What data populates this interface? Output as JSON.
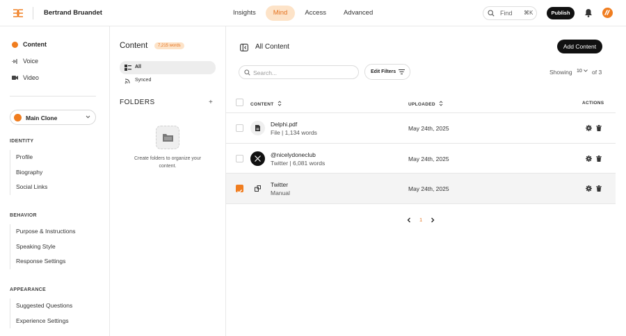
{
  "header": {
    "user_name": "Bertrand Bruandet",
    "nav": [
      {
        "label": "Insights",
        "active": false
      },
      {
        "label": "Mind",
        "active": true
      },
      {
        "label": "Access",
        "active": false
      },
      {
        "label": "Advanced",
        "active": false
      }
    ],
    "find_label": "Find",
    "find_shortcut": "⌘K",
    "publish_label": "Publish"
  },
  "sidebar": {
    "top_items": [
      {
        "label": "Content",
        "icon": "content-dot-icon"
      },
      {
        "label": "Voice",
        "icon": "voice-icon"
      },
      {
        "label": "Video",
        "icon": "video-icon"
      }
    ],
    "clone_label": "Main Clone",
    "identity_title": "IDENTITY",
    "identity_items": [
      "Profile",
      "Biography",
      "Social Links"
    ],
    "behavior_title": "BEHAVIOR",
    "behavior_items": [
      "Purpose & Instructions",
      "Speaking Style",
      "Response Settings"
    ],
    "appearance_title": "APPEARANCE",
    "appearance_items": [
      "Suggested Questions",
      "Experience Settings"
    ]
  },
  "content_panel": {
    "title": "Content",
    "word_badge": "7,215 words",
    "filters": [
      "All",
      "Synced"
    ],
    "folders_title": "FOLDERS",
    "folders_add": "+",
    "empty_text": "Create folders to organize your content."
  },
  "main": {
    "title": "All Content",
    "add_button": "Add Content",
    "search_placeholder": "Search...",
    "edit_filters": "Edit Filters",
    "showing_label": "Showing",
    "page_size": "10",
    "of_label": "of 3",
    "columns": {
      "content": "CONTENT",
      "uploaded": "UPLOADED",
      "actions": "ACTIONS"
    },
    "rows": [
      {
        "name": "Delphi.pdf",
        "sub": "File | 1,134 words",
        "date": "May 24th, 2025",
        "checked": false,
        "icon": "document-icon"
      },
      {
        "name": "@nicelydoneclub",
        "sub": "Twitter | 6,081 words",
        "date": "May 24th, 2025",
        "checked": false,
        "icon": "x-logo-icon"
      },
      {
        "name": "Twitter",
        "sub": "Manual",
        "date": "May 24th, 2025",
        "checked": true,
        "icon": "manual-icon"
      }
    ],
    "pagination": {
      "current": "1"
    }
  },
  "colors": {
    "accent": "#f07d1f",
    "accent_soft": "#fde3c8",
    "dark": "#111111"
  }
}
